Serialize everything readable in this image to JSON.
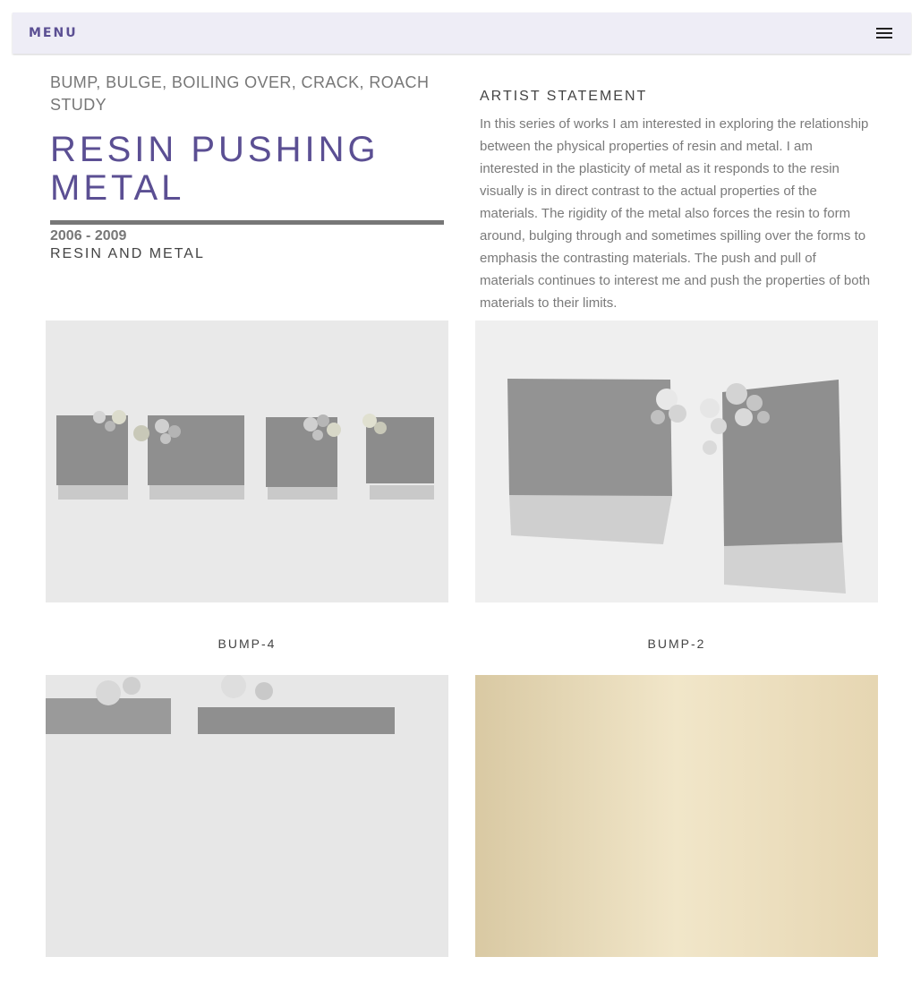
{
  "nav": {
    "menu_label": "MENU",
    "menu_icon": "hamburger-menu-icon"
  },
  "work": {
    "subtitle": "BUMP, BULGE, BOILING OVER, CRACK, ROACH STUDY",
    "title": "RESIN PUSHING METAL",
    "years": "2006 - 2009",
    "medium": "RESIN AND METAL"
  },
  "statement": {
    "heading": "ARTIST STATEMENT",
    "body": "In this series of works I am interested in exploring the relationship between the physical properties of resin and metal. I am interested in the plasticity of metal as it responds to the resin visually is in direct contrast to the actual properties of the materials. The rigidity of the metal also forces the resin to form around, bulging through and sometimes spilling over the forms to emphasis the contrasting materials. The push and pull of materials continues to interest me and push the properties of both materials to their limits."
  },
  "gallery": [
    {
      "caption": "BUMP-4"
    },
    {
      "caption": "BUMP-2"
    },
    {
      "caption": ""
    },
    {
      "caption": ""
    }
  ],
  "colors": {
    "accent": "#5b4f93",
    "menu_bg": "#eeedf6",
    "text_gray": "#777777"
  }
}
